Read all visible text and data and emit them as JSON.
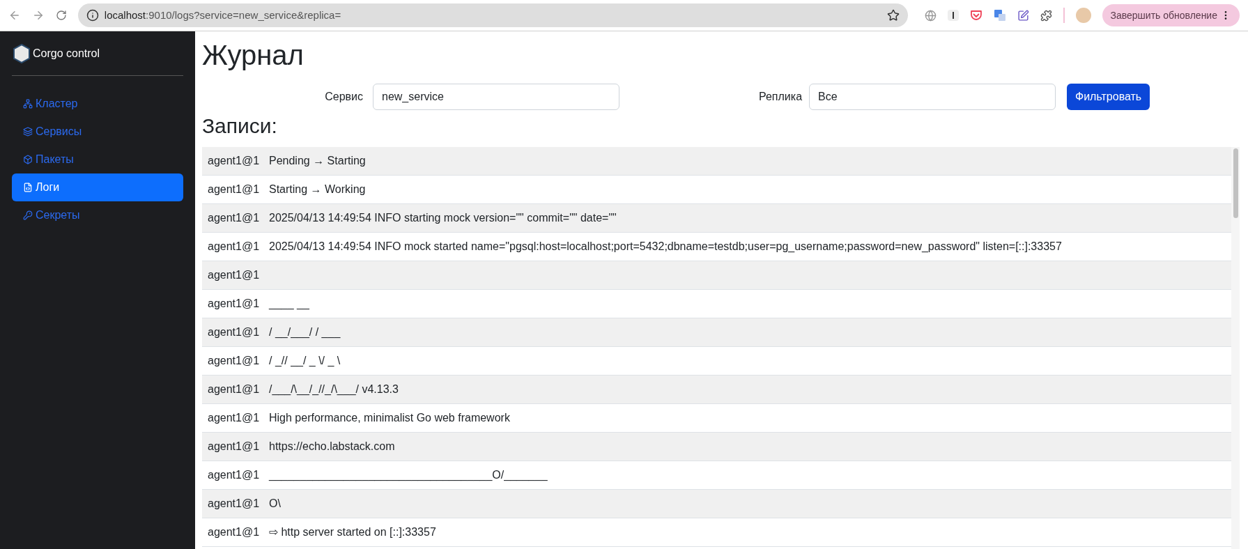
{
  "browser": {
    "url_host": "localhost",
    "url_rest": ":9010/logs?service=new_service&replica=",
    "update_button": "Завершить обновление"
  },
  "sidebar": {
    "brand": "Corgo control",
    "items": [
      {
        "label": "Кластер",
        "selected": false
      },
      {
        "label": "Сервисы",
        "selected": false
      },
      {
        "label": "Пакеты",
        "selected": false
      },
      {
        "label": "Логи",
        "selected": true
      },
      {
        "label": "Секреты",
        "selected": false
      }
    ]
  },
  "page": {
    "title": "Журнал",
    "filters": [
      {
        "label": "Сервис",
        "value": "new_service"
      },
      {
        "label": "Реплика",
        "value": "Все"
      }
    ],
    "filter_button": "Фильтровать",
    "records_title": "Записи:"
  },
  "log_rows": [
    {
      "source": "agent1@1",
      "message": "Pending → Starting"
    },
    {
      "source": "agent1@1",
      "message": "Starting → Working"
    },
    {
      "source": "agent1@1",
      "message": "2025/04/13 14:49:54 INFO starting mock version=\"\" commit=\"\" date=\"\""
    },
    {
      "source": "agent1@1",
      "message": "2025/04/13 14:49:54 INFO mock started name=\"pgsql:host=localhost;port=5432;dbname=testdb;user=pg_username;password=new_password\" listen=[::]:33357"
    },
    {
      "source": "agent1@1"
    },
    {
      "source": "agent1@1",
      "message": "____ __"
    },
    {
      "source": "agent1@1",
      "message": "/ __/___/ / ___"
    },
    {
      "source": "agent1@1",
      "message": "/ _// __/ _ \\/ _ \\"
    },
    {
      "source": "agent1@1",
      "message": "/___/\\__/_//_/\\___/ v4.13.3"
    },
    {
      "source": "agent1@1",
      "message": "High performance, minimalist Go web framework"
    },
    {
      "source": "agent1@1",
      "message": "https://echo.labstack.com"
    },
    {
      "source": "agent1@1",
      "message": "____________________________________O/_______"
    },
    {
      "source": "agent1@1",
      "message": "O\\"
    },
    {
      "source": "agent1@1",
      "message": "⇨ http server started on [::]:33357"
    }
  ]
}
